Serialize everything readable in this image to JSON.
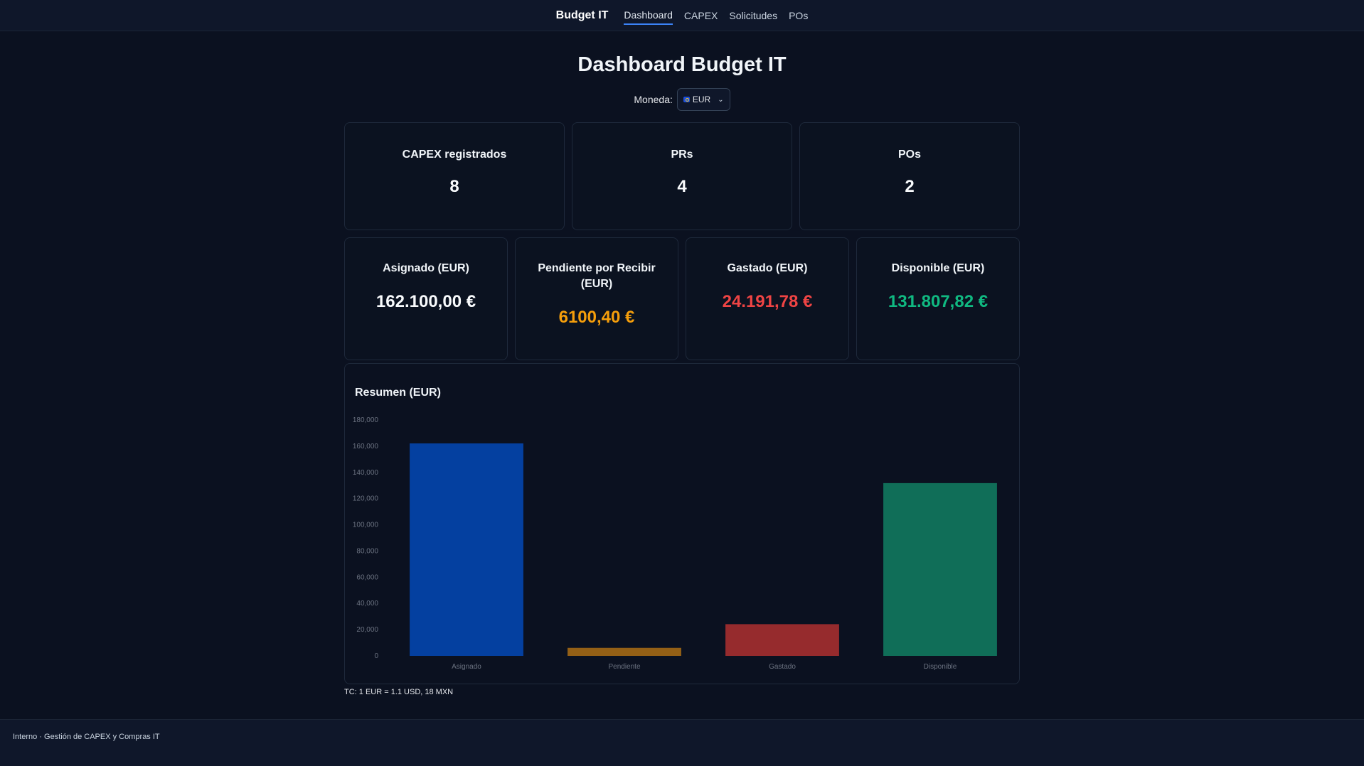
{
  "nav": {
    "brand": "Budget IT",
    "links": [
      "Dashboard",
      "CAPEX",
      "Solicitudes",
      "POs"
    ],
    "active": "Dashboard"
  },
  "page": {
    "title": "Dashboard Budget IT",
    "currency_label": "Moneda:",
    "currency_value": "EUR",
    "currency_icon": "eu-flag-icon"
  },
  "counts": [
    {
      "label": "CAPEX registrados",
      "value": "8"
    },
    {
      "label": "PRs",
      "value": "4"
    },
    {
      "label": "POs",
      "value": "2"
    }
  ],
  "amounts": [
    {
      "label": "Asignado (EUR)",
      "value": "162.100,00 €",
      "color": "#f8fafc"
    },
    {
      "label": "Pendiente por Recibir (EUR)",
      "value": "6100,40 €",
      "color": "#f59e0b"
    },
    {
      "label": "Gastado (EUR)",
      "value": "24.191,78 €",
      "color": "#ef4444"
    },
    {
      "label": "Disponible (EUR)",
      "value": "131.807,82 €",
      "color": "#10b981"
    }
  ],
  "chart_title": "Resumen (EUR)",
  "chart_data": {
    "type": "bar",
    "title": "Resumen (EUR)",
    "categories": [
      "Asignado",
      "Pendiente",
      "Gastado",
      "Disponible"
    ],
    "values": [
      162100.0,
      6100.4,
      24191.78,
      131807.82
    ],
    "colors": [
      "#0440a0",
      "#946016",
      "#962b2d",
      "#106e58"
    ],
    "ylim": [
      0,
      180000
    ],
    "yticks": [
      "0",
      "20,000",
      "40,000",
      "60,000",
      "80,000",
      "100,000",
      "120,000",
      "140,000",
      "160,000",
      "180,000"
    ],
    "grid": false,
    "legend": "none"
  },
  "fx_note": "TC: 1 EUR = 1.1 USD, 18 MXN",
  "footer": "Interno · Gestión de CAPEX y Compras IT"
}
